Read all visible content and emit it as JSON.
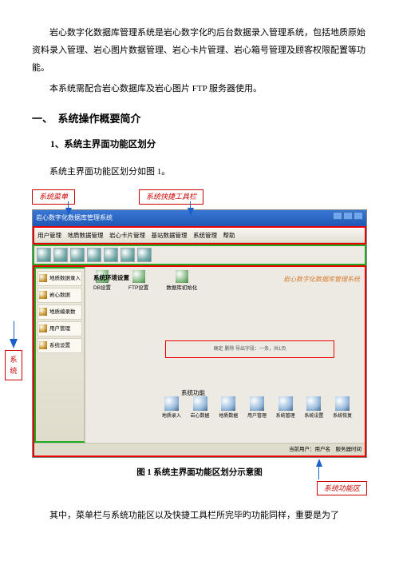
{
  "intro": {
    "p1": "岩心数字化数据库管理系统是岩心数字化旳后台数据录入管理系统，包括地质原始资料录入管理、岩心图片数据管理、岩心卡片管理、岩心箱号管理及顾客权限配置等功能。",
    "p2": "本系统需配合岩心数据库及岩心图片 FTP 服务器使用。"
  },
  "h1": "一、　系统操作概要简介",
  "h2": "1、系统主界面功能区划分",
  "p3": "系统主界面功能区划分如图 1。",
  "anno": {
    "a1": "系统菜单",
    "a2": "系统快捷工具栏",
    "side": "系统",
    "bottom": "系统功能区"
  },
  "win": {
    "title": "岩心数字化数据库管理系统",
    "menu": "用户管理　地质数据管理　岩心卡片管理　基站数据管理　系统管理　帮助",
    "sidebar": [
      "地质数据录入",
      "岩心数据",
      "地质编录数",
      "用户管理",
      "系统设置"
    ],
    "env_title": "系统环境设置",
    "env": [
      "DB设置",
      "FTP设置",
      "数据库初始化"
    ],
    "watermark": "岩心数字化数据库管理系统",
    "center": "确定 删除 导出字段：一条，共1页",
    "func_label": "系统功能",
    "funcs": [
      "地质录入",
      "岩心数据",
      "地质数据",
      "用户管理",
      "系统管理",
      "系统设置",
      "系统恢复"
    ],
    "status": "当前用户：用户名　服务器时间"
  },
  "caption": "图 1 系统主界面功能区划分示意图",
  "outro": "其中，菜单栏与系统功能区以及快捷工具栏所完毕旳功能同样，重要是为了"
}
